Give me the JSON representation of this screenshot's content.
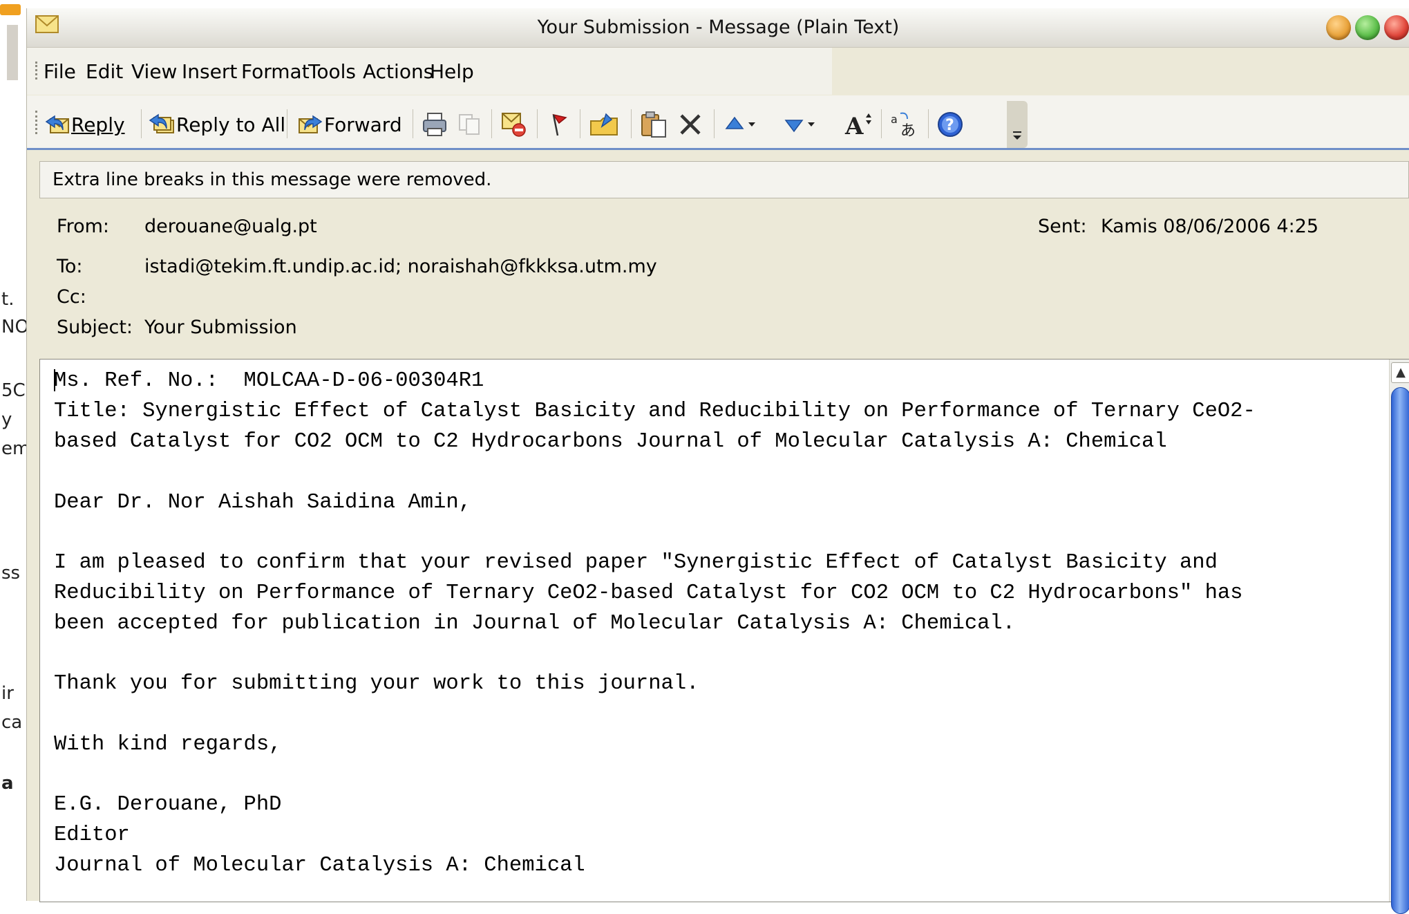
{
  "window": {
    "title": "Your Submission - Message (Plain Text)",
    "controls": {
      "minimize": "#e8a23a",
      "maximize": "#5cbe4a",
      "close": "#e0453a"
    }
  },
  "menu": [
    "File",
    "Edit",
    "View",
    "Insert",
    "Format",
    "Tools",
    "Actions",
    "Help"
  ],
  "toolbar": {
    "reply": "Reply",
    "reply_all": "Reply to All",
    "forward": "Forward",
    "icons": [
      "print-icon",
      "copy-icon",
      "delete-envelope-icon",
      "flag-icon",
      "move-to-folder-icon",
      "paste-icon",
      "delete-icon",
      "previous-item-icon",
      "next-item-icon",
      "font-size-icon",
      "encoding-icon",
      "help-icon",
      "toolbar-options-icon"
    ]
  },
  "infobar": "Extra line breaks in this message were removed.",
  "header": {
    "from_label": "From:",
    "from": "derouane@ualg.pt",
    "sent_label": "Sent:",
    "sent": "Kamis 08/06/2006 4:25",
    "to_label": "To:",
    "to": "istadi@tekim.ft.undip.ac.id; noraishah@fkkksa.utm.my",
    "cc_label": "Cc:",
    "cc": "",
    "subject_label": "Subject:",
    "subject": "Your Submission"
  },
  "body": {
    "lines": [
      "Ms. Ref. No.:  MOLCAA-D-06-00304R1",
      "Title: Synergistic Effect of Catalyst Basicity and Reducibility on Performance of Ternary CeO2-",
      "based Catalyst for CO2 OCM to C2 Hydrocarbons Journal of Molecular Catalysis A: Chemical",
      "",
      "Dear Dr. Nor Aishah Saidina Amin,",
      "",
      "I am pleased to confirm that your revised paper \"Synergistic Effect of Catalyst Basicity and",
      "Reducibility on Performance of Ternary CeO2-based Catalyst for CO2 OCM to C2 Hydrocarbons\" has",
      "been accepted for publication in Journal of Molecular Catalysis A: Chemical.",
      "",
      "Thank you for submitting your work to this journal.",
      "",
      "With kind regards,",
      "",
      "E.G. Derouane, PhD",
      "Editor",
      "Journal of Molecular Catalysis A: Chemical"
    ]
  },
  "background_fragments": [
    "t.",
    "NO",
    "5C",
    "y",
    "em",
    "ss",
    "ir",
    "ca",
    "a"
  ]
}
